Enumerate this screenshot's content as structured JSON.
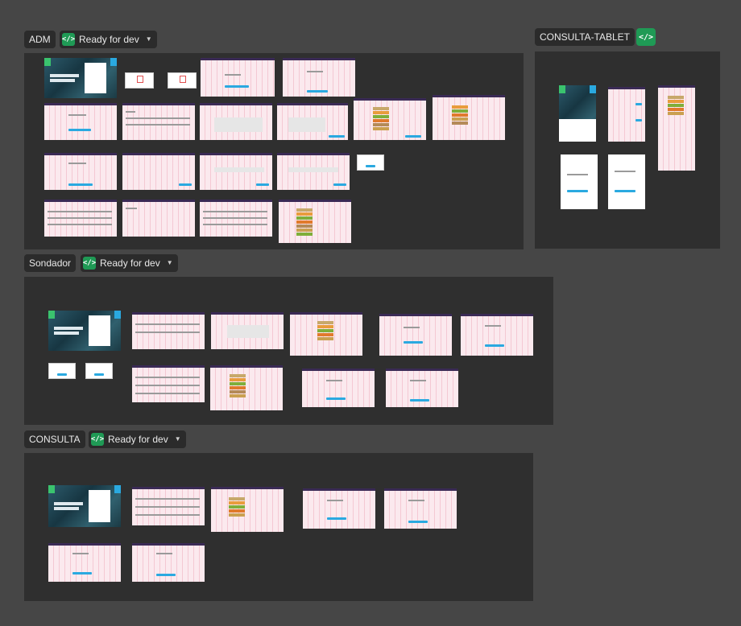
{
  "sections": {
    "adm": {
      "name": "ADM",
      "status": "Ready for dev"
    },
    "consulta_tablet": {
      "name": "CONSULTA-TABLET"
    },
    "sondador": {
      "name": "Sondador",
      "status": "Ready for dev"
    },
    "consulta": {
      "name": "CONSULTA",
      "status": "Ready for dev"
    }
  },
  "icons": {
    "code": "code-icon",
    "chevron": "chevron-down-icon"
  },
  "colors": {
    "canvas": "#464646",
    "section": "#2f2f2f",
    "ready_green": "#1f9a55",
    "frame_pink": "#fbe9ee",
    "accent_blue": "#2aa9e0"
  }
}
